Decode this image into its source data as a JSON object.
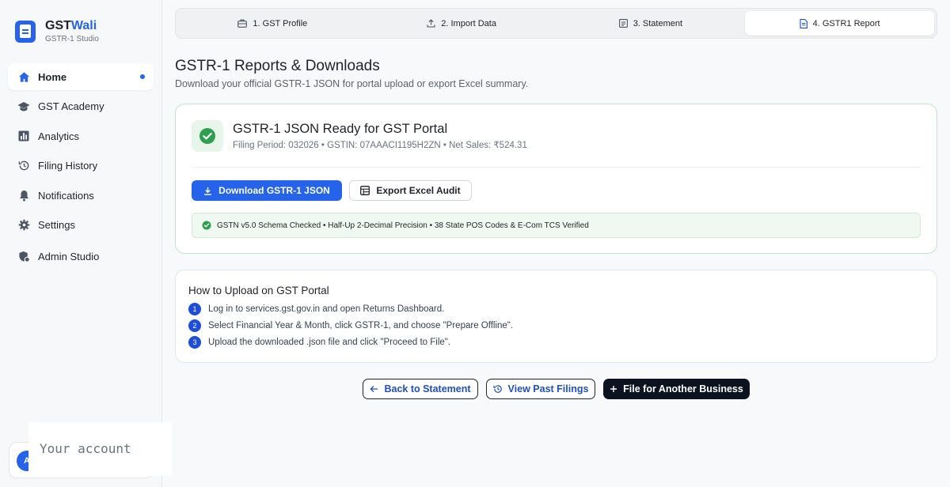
{
  "brand": {
    "name_part1": "GST",
    "name_part2": "Wali",
    "subtitle": "GSTR-1 Studio"
  },
  "sidebar": {
    "items": [
      {
        "label": "Home",
        "icon": "home-icon",
        "active": true
      },
      {
        "label": "GST Academy",
        "icon": "graduation-cap-icon"
      },
      {
        "label": "Analytics",
        "icon": "bar-chart-icon"
      },
      {
        "label": "Filing History",
        "icon": "history-icon"
      },
      {
        "label": "Notifications",
        "icon": "bell-icon"
      },
      {
        "label": "Settings",
        "icon": "gear-icon"
      },
      {
        "label": "Admin Studio",
        "icon": "admin-shield-icon"
      }
    ]
  },
  "account": {
    "avatar_initial": "A",
    "popover_text": "Your account"
  },
  "stepper": {
    "steps": [
      {
        "label": "1. GST Profile",
        "icon": "briefcase-icon"
      },
      {
        "label": "2. Import Data",
        "icon": "upload-icon"
      },
      {
        "label": "3. Statement",
        "icon": "statement-icon"
      },
      {
        "label": "4. GSTR1 Report",
        "icon": "report-icon",
        "active": true
      }
    ]
  },
  "page": {
    "title": "GSTR-1 Reports & Downloads",
    "subtitle": "Download your official GSTR-1 JSON for portal upload or export Excel summary."
  },
  "ready": {
    "title": "GSTR-1 JSON Ready for GST Portal",
    "meta": "Filing Period: 032026 • GSTIN: 07AAACI1195H2ZN • Net Sales: ₹524.31",
    "download_label": "Download GSTR-1 JSON",
    "export_label": "Export Excel Audit",
    "verify_text": "GSTN v5.0 Schema Checked • Half-Up 2-Decimal Precision • 38 State POS Codes & E-Com TCS Verified"
  },
  "howto": {
    "title": "How to Upload on GST Portal",
    "steps": [
      {
        "num": "1",
        "text": "Log in to services.gst.gov.in and open Returns Dashboard."
      },
      {
        "num": "2",
        "text": "Select Financial Year & Month, click GSTR-1, and choose \"Prepare Offline\"."
      },
      {
        "num": "3",
        "text": "Upload the downloaded .json file and click \"Proceed to File\"."
      }
    ]
  },
  "actions": {
    "back_label": "Back to Statement",
    "past_label": "View Past Filings",
    "another_label": "File for Another Business"
  },
  "colors": {
    "accent": "#2563eb",
    "success": "#2e9e4f",
    "dark_button": "#0b1220"
  }
}
